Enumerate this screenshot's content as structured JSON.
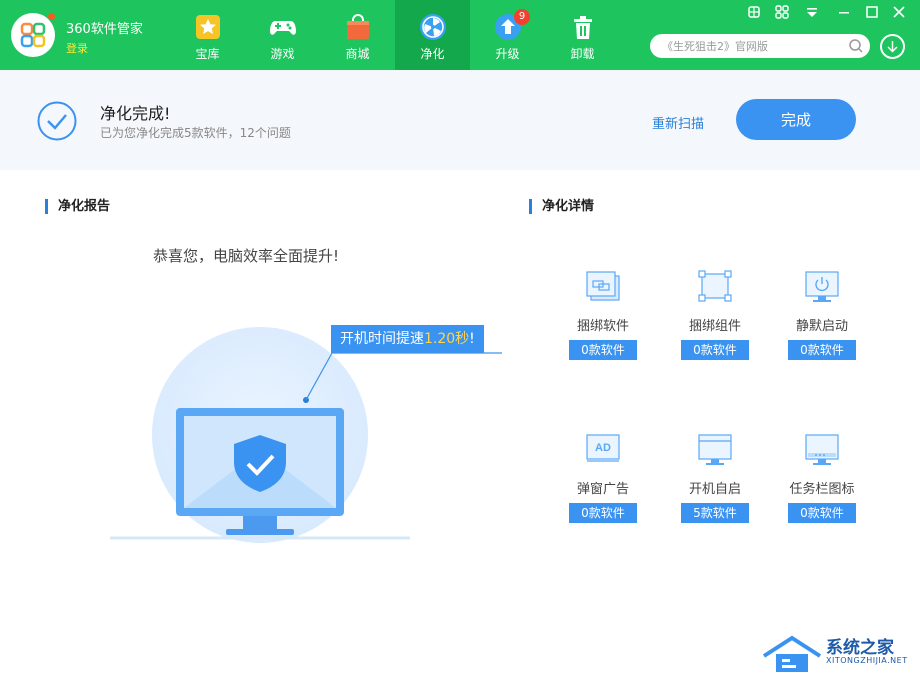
{
  "header": {
    "app_title": "360软件管家",
    "login_label": "登录",
    "tabs": [
      {
        "label": "宝库",
        "icon": "star-box-icon"
      },
      {
        "label": "游戏",
        "icon": "gamepad-icon"
      },
      {
        "label": "商城",
        "icon": "shopping-bag-icon"
      },
      {
        "label": "净化",
        "icon": "fan-icon",
        "active": true
      },
      {
        "label": "升级",
        "icon": "upgrade-arrow-icon",
        "badge": "9"
      },
      {
        "label": "卸载",
        "icon": "trash-icon"
      }
    ],
    "search_placeholder": "《生死狙击2》官网版",
    "window_controls": [
      "skin-icon",
      "settings-icon",
      "menu-icon",
      "minimize-icon",
      "maximize-icon",
      "close-icon"
    ]
  },
  "status": {
    "title": "净化完成!",
    "subtitle": "已为您净化完成5款软件，12个问题",
    "rescan_label": "重新扫描",
    "done_label": "完成"
  },
  "report": {
    "section_title": "净化报告",
    "congrats": "恭喜您，电脑效率全面提升!",
    "speed_prefix": "开机时间提速",
    "speed_value": "1.20秒",
    "speed_suffix": "!"
  },
  "details": {
    "section_title": "净化详情",
    "items": [
      {
        "label": "捆绑软件",
        "count": "0款软件",
        "icon": "bundled-software-icon"
      },
      {
        "label": "捆绑组件",
        "count": "0款软件",
        "icon": "bundled-component-icon"
      },
      {
        "label": "静默启动",
        "count": "0款软件",
        "icon": "silent-start-icon"
      },
      {
        "label": "弹窗广告",
        "count": "0款软件",
        "icon": "popup-ad-icon"
      },
      {
        "label": "开机自启",
        "count": "5款软件",
        "icon": "auto-start-icon"
      },
      {
        "label": "任务栏图标",
        "count": "0款软件",
        "icon": "taskbar-icon"
      }
    ]
  },
  "watermark": {
    "name": "系统之家",
    "url": "XITONGZHIJIA.NET"
  },
  "colors": {
    "header_green": "#1ec45e",
    "active_tab_green": "#14a84d",
    "accent_blue": "#3a93f0",
    "link_blue": "#2a7fd8",
    "speed_highlight": "#ffd54a"
  }
}
